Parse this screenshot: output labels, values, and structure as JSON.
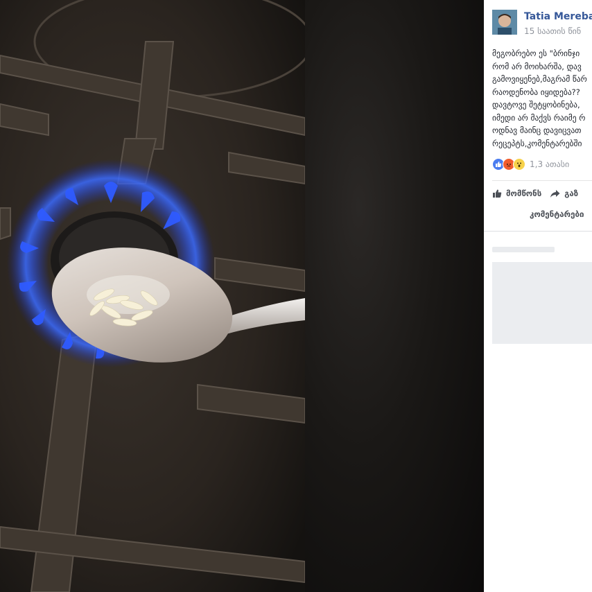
{
  "post": {
    "author": "Tatia Merebas",
    "timestamp": "15 საათის წინ",
    "text_lines": [
      "მეგობრებო ეს \"ბრინჯი",
      "რომ არ მოიხარშა, დავ",
      "გამოვიყენებ,მაგრამ წარ",
      "რაოდენობა იყიდება??",
      "დავტოვე შეტყობინება,",
      "იმედი არ მაქვს რაიმე რ",
      "ოდნავ მაინც დავიცვათ",
      "რეცეპტს,კომენტარებში"
    ]
  },
  "reactions": {
    "icons": [
      "like-icon",
      "angry-icon",
      "wow-icon"
    ],
    "count": "1,3 ათასი"
  },
  "actions": {
    "like_label": "მომწონს",
    "share_label": "გაზ",
    "comments_label": "კომენტარები"
  },
  "colors": {
    "author_link": "#365899",
    "meta_text": "#90949c",
    "action_text": "#4b4f56",
    "flame_blue": "#2f5bff"
  }
}
